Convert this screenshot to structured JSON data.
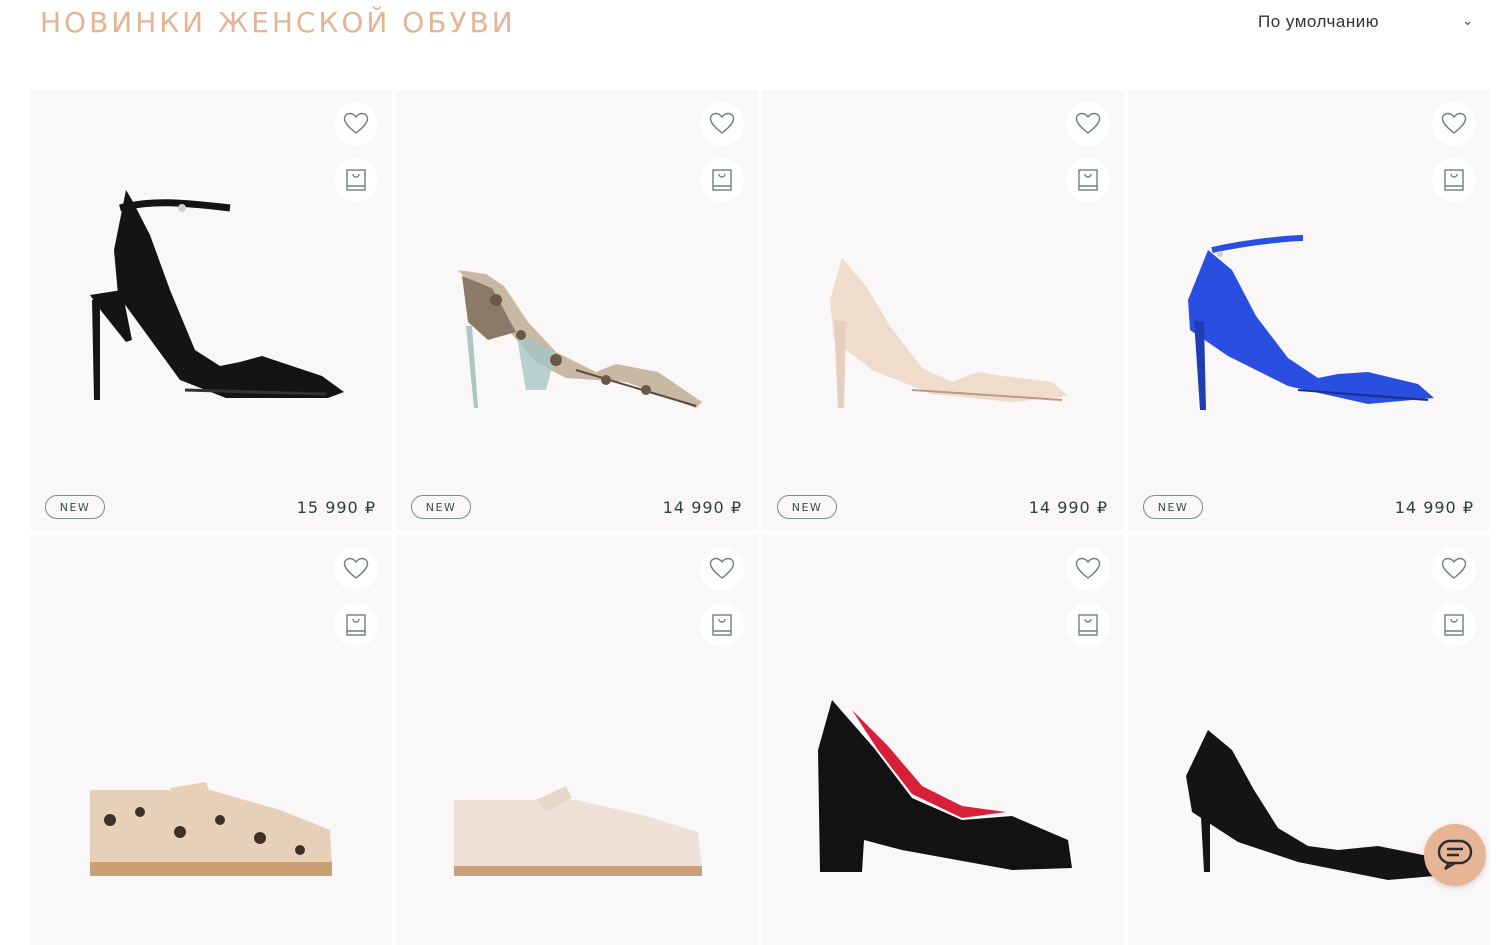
{
  "page": {
    "title": "НОВИНКИ ЖЕНСКОЙ ОБУВИ",
    "sort_label": "По умолчанию",
    "accent_color": "#e3b495"
  },
  "products": [
    {
      "badge": "NEW",
      "price": "15 990 ₽",
      "image": "black-patent-ankle-strap-pump"
    },
    {
      "badge": "NEW",
      "price": "14 990 ₽",
      "image": "snakeskin-dorsay-pump"
    },
    {
      "badge": "NEW",
      "price": "14 990 ₽",
      "image": "beige-leather-pump"
    },
    {
      "badge": "NEW",
      "price": "14 990 ₽",
      "image": "blue-ankle-strap-pump"
    },
    {
      "image": "snakeskin-mary-jane-flat"
    },
    {
      "image": "cream-mary-jane-flat"
    },
    {
      "image": "black-suede-platform-pump"
    },
    {
      "image": "black-leather-pump"
    }
  ],
  "icons": {
    "favorite": "heart-icon",
    "cart": "bag-icon",
    "chat": "chat-icon",
    "sort": "chevron-down-icon"
  }
}
